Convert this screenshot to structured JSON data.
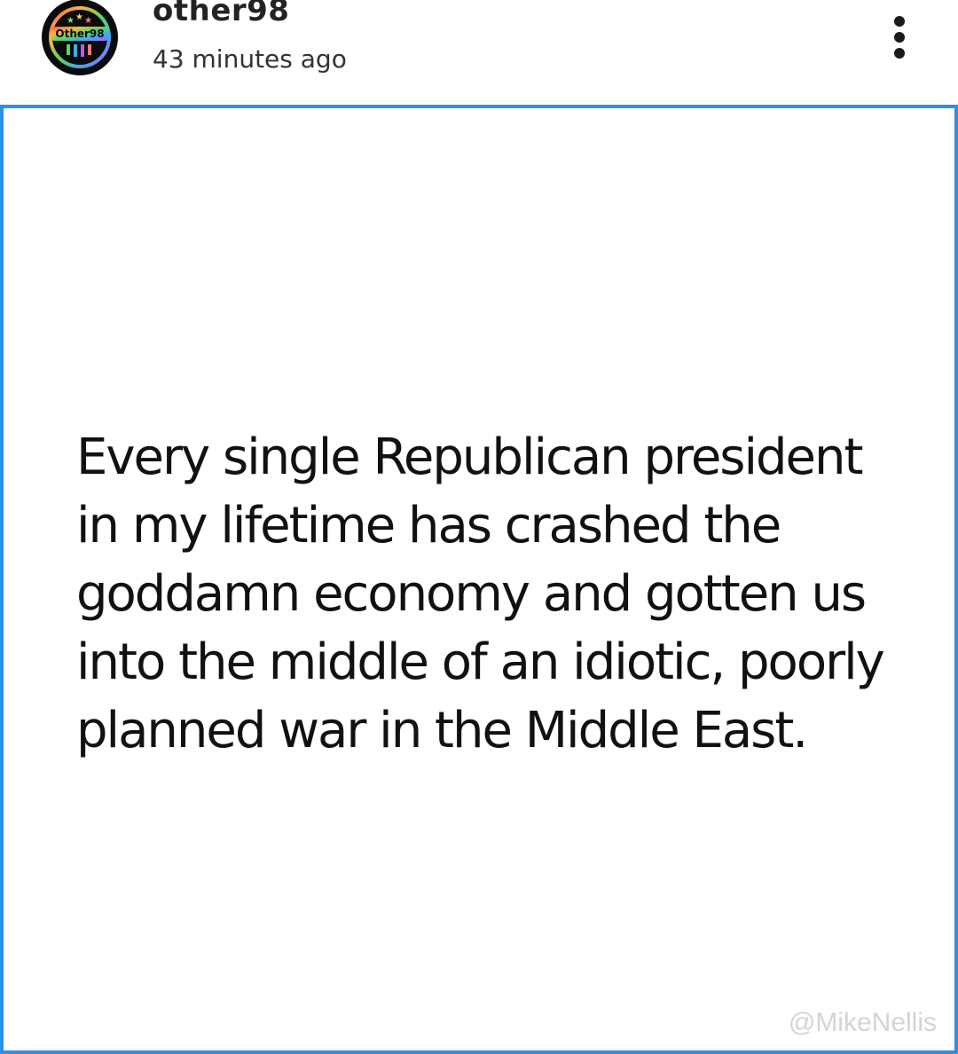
{
  "post": {
    "author": {
      "username": "other98",
      "avatar_text": "Other98",
      "avatar_icon": "other98-logo"
    },
    "timestamp": "43 minutes ago",
    "menu_icon": "more-vertical-icon",
    "body": "Every single Republican president in my lifetime has crashed the goddamn economy and gotten us into the middle of an idiotic, poorly planned war in the Middle East.",
    "watermark": "@MikeNellis"
  },
  "colors": {
    "card_border": "#2d8fe6",
    "text": "#111111",
    "watermark": "#d4d4d4"
  }
}
